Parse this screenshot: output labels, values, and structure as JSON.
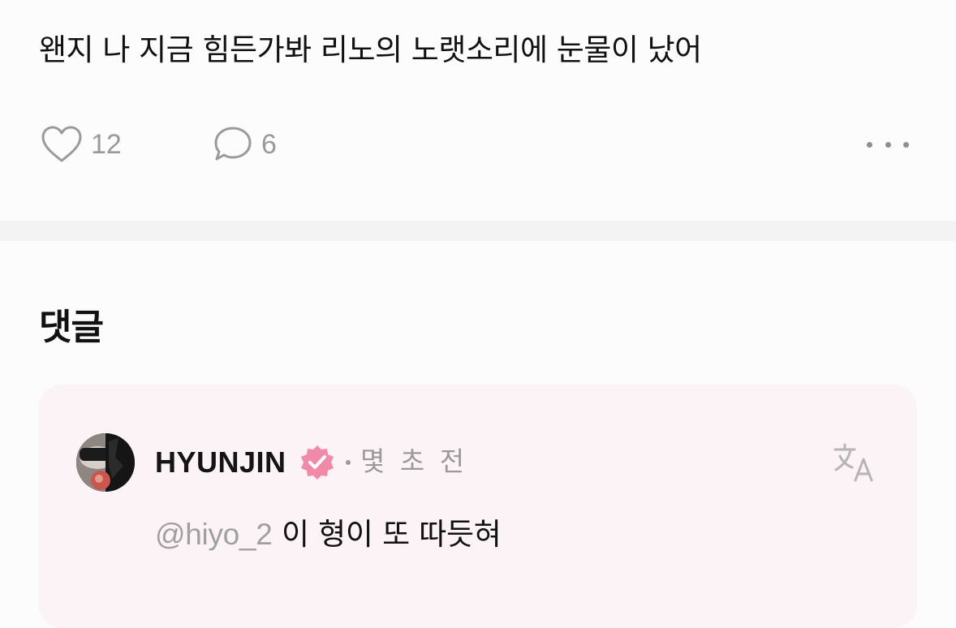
{
  "post": {
    "text": "왠지 나 지금 힘든가봐 리노의 노랫소리에 눈물이 났어",
    "likes": "12",
    "comments": "6",
    "like_icon": "heart-outline-icon",
    "comment_icon": "speech-bubble-icon",
    "more_icon": "more-horizontal-icon"
  },
  "comments_section": {
    "heading": "댓글",
    "items": [
      {
        "username": "HYUNJIN",
        "verified_icon": "verified-badge-icon",
        "verified_color": "#f08aa8",
        "timestamp": "몇 초 전",
        "translate_icon": "translate-icon",
        "mention": "@hiyo_2",
        "text": " 이 형이 또 따듯혀"
      }
    ]
  },
  "colors": {
    "background": "#fdfcfd",
    "divider": "#f4f3f4",
    "comment_card": "#fcf3f6",
    "muted_text": "#9a9a9a",
    "primary_text": "#111111"
  }
}
